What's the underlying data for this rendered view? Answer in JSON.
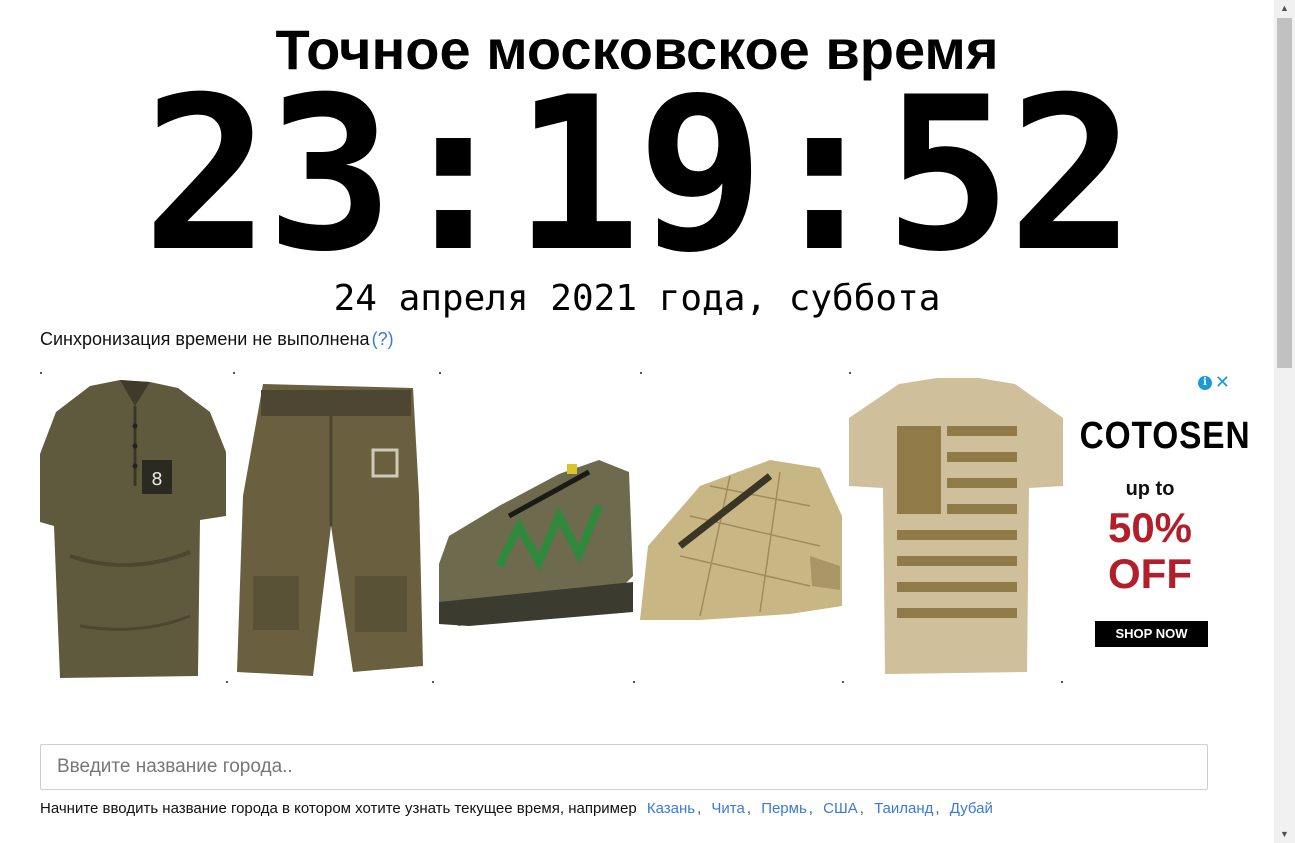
{
  "header": {
    "title": "Точное московское время",
    "time": "23:19:52",
    "date": "24 апреля 2021 года, суббота"
  },
  "sync": {
    "text": "Синхронизация времени не выполнена",
    "help_link": "(?)"
  },
  "ad": {
    "products": [
      {
        "name": "henley-shirt-image"
      },
      {
        "name": "cargo-shorts-image"
      },
      {
        "name": "camo-sneaker-image"
      },
      {
        "name": "flat-cap-image"
      },
      {
        "name": "flag-tshirt-image"
      }
    ],
    "brand": "COTOSEN",
    "promo_upto": "up to",
    "promo_percent": "50%",
    "promo_off": "OFF",
    "cta": "SHOP NOW",
    "colors": {
      "discount": "#b21e2a",
      "adchoices": "#1a9bd7"
    }
  },
  "search": {
    "placeholder": "Введите название города..",
    "value": ""
  },
  "hint": {
    "text": "Начните вводить название города в котором хотите узнать текущее время, например",
    "examples": [
      "Казань",
      "Чита",
      "Пермь",
      "США",
      "Таиланд",
      "Дубай"
    ],
    "separator": ","
  },
  "colors": {
    "link": "#3a7bd5",
    "text": "#000000"
  }
}
